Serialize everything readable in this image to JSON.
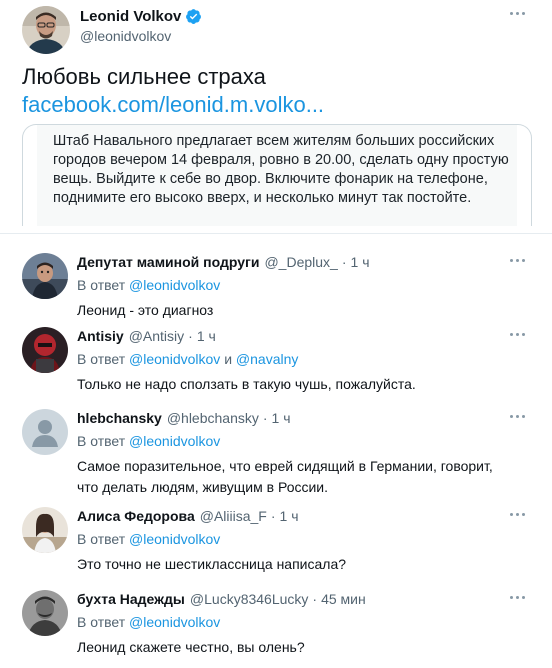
{
  "tweet": {
    "author_name": "Leonid Volkov",
    "author_handle": "@leonidvolkov",
    "text": "Любовь сильнее страха",
    "link": "facebook.com/leonid.m.volko...",
    "quote_text": "Штаб Навального предлагает всем жителям больших российских городов вечером 14 февраля, ровно в 20.00, сделать одну простую вещь. Выйдите к себе во двор. Включите фонарик на телефоне, поднимите его высоко вверх, и несколько минут так постойте.",
    "verified_color": "#1da1f2"
  },
  "replies": [
    {
      "name": "Депутат маминой подруги",
      "handle": "@_Deplux_",
      "sep": "·",
      "time": "1 ч",
      "in_reply_prefix": "В ответ",
      "mention1": "@leonidvolkov",
      "text": "Леонид - это диагноз"
    },
    {
      "name": "Antisiy",
      "handle": "@Antisiy",
      "sep": "·",
      "time": "1 ч",
      "in_reply_prefix": "В ответ",
      "mention1": "@leonidvolkov",
      "conjunction": "и",
      "mention2": "@navalny",
      "text": "Только не надо сползать в такую чушь, пожалуйста."
    },
    {
      "name": "hlebchansky",
      "handle": "@hlebchansky",
      "sep": "·",
      "time": "1 ч",
      "in_reply_prefix": "В ответ",
      "mention1": "@leonidvolkov",
      "text": "Самое поразительное, что еврей сидящий в Германии, говорит, что делать людям, живущим в России."
    },
    {
      "name": "Алиса Федорова",
      "handle": "@Aliiisa_F",
      "sep": "·",
      "time": "1 ч",
      "in_reply_prefix": "В ответ",
      "mention1": "@leonidvolkov",
      "text": "Это точно не шестиклассница написала?"
    },
    {
      "name": "бухта Надежды",
      "handle": "@Lucky8346Lucky",
      "sep": "·",
      "time": "45 мин",
      "in_reply_prefix": "В ответ",
      "mention1": "@leonidvolkov",
      "text": "Леонид скажете честно, вы олень?"
    }
  ],
  "colors": {
    "link": "#1b95e0",
    "secondary_text": "#536471",
    "primary_text": "#0f1419"
  }
}
